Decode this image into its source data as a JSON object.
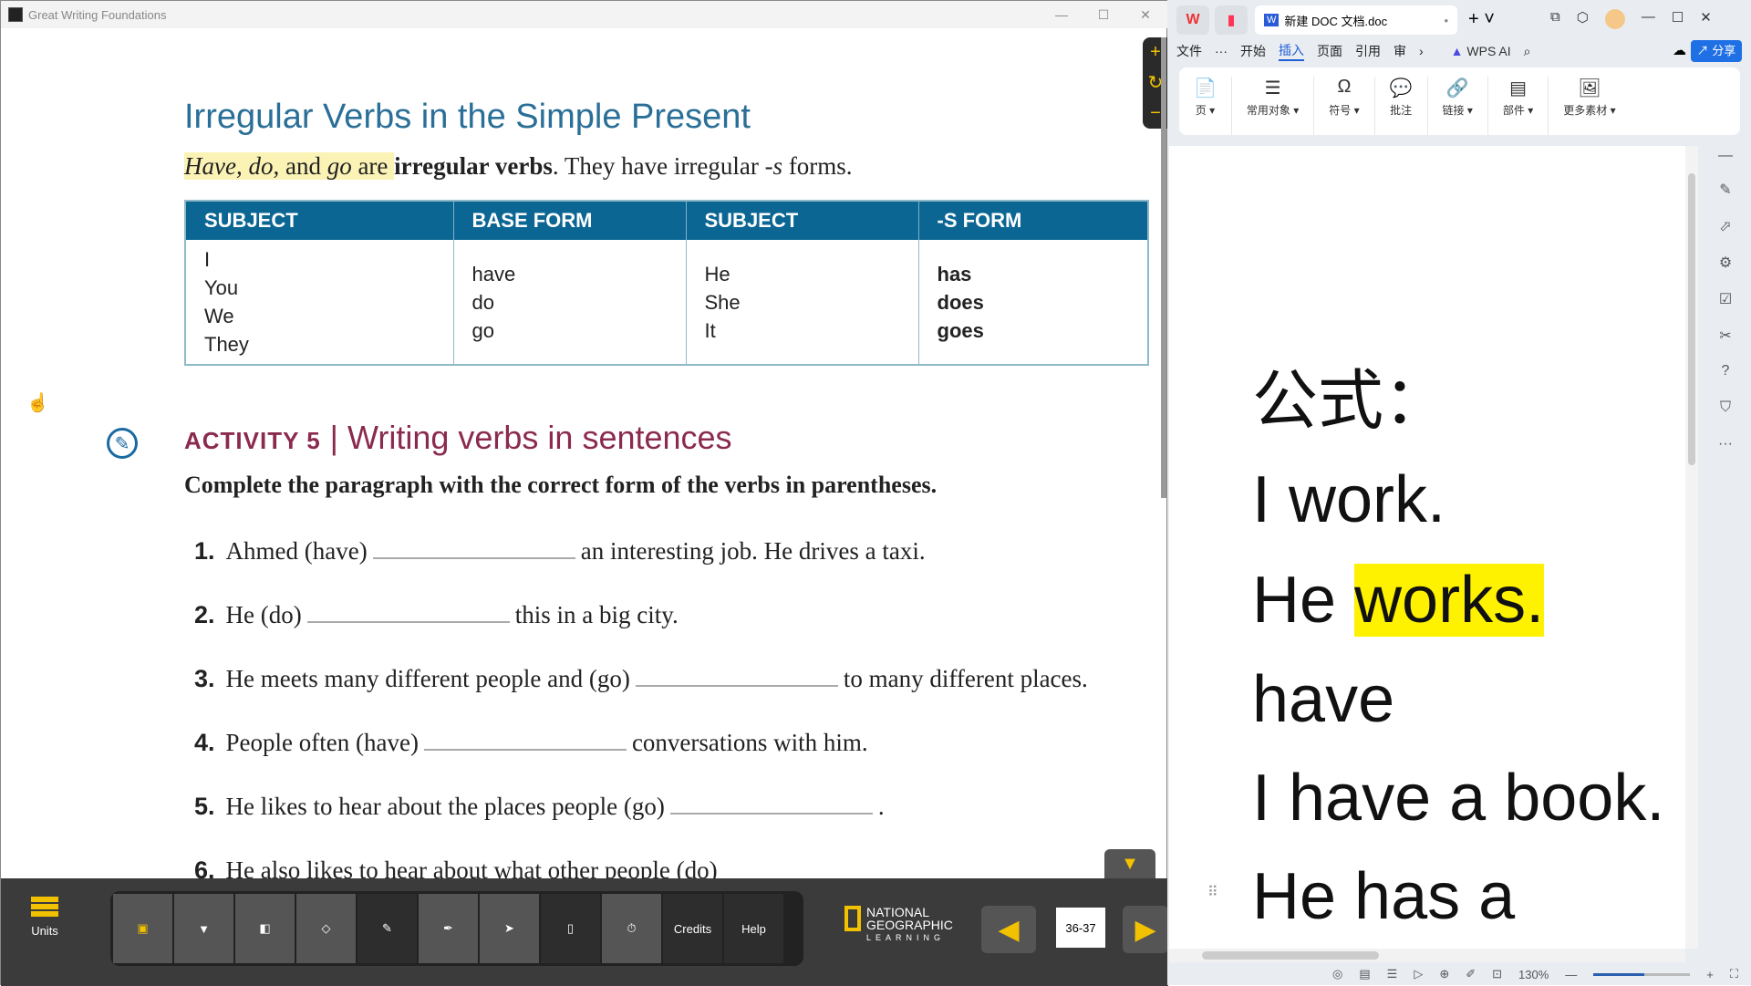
{
  "left_window": {
    "title": "Great Writing Foundations",
    "controls": [
      "—",
      "☐",
      "✕"
    ]
  },
  "book": {
    "title": "Irregular Verbs in the Simple Present",
    "sub_hl_italic1": "Have, do,",
    "sub_hl_and": " and ",
    "sub_hl_italic2": "go",
    "sub_hl_are": " are ",
    "sub_bold": "irregular verbs",
    "sub_rest": ". They have irregular ",
    "sub_s": "-s",
    "sub_end": " forms.",
    "table": {
      "headers": [
        "SUBJECT",
        "BASE FORM",
        "SUBJECT",
        "-S FORM"
      ],
      "subjects": [
        "I",
        "You",
        "We",
        "They"
      ],
      "base": [
        "have",
        "do",
        "go"
      ],
      "subjects3": [
        "He",
        "She",
        "It"
      ],
      "sforms": [
        "has",
        "does",
        "goes"
      ]
    },
    "activity_label": "ACTIVITY 5",
    "activity_title": "Writing verbs in sentences",
    "instruction": "Complete the paragraph with the correct form of the verbs in parentheses.",
    "items": [
      {
        "n": "1.",
        "pre": "Ahmed (have)",
        "post": "an interesting job. He drives a taxi."
      },
      {
        "n": "2.",
        "pre": "He (do)",
        "post": "this in a big city."
      },
      {
        "n": "3.",
        "pre": "He meets many different people and (go)",
        "post": "to many different places."
      },
      {
        "n": "4.",
        "pre": "People often (have)",
        "post": "conversations with him."
      },
      {
        "n": "5.",
        "pre": "He likes to hear about the places people (go)",
        "post": "."
      },
      {
        "n": "6.",
        "pre": "He also likes to hear about what other people (do)",
        "post": ""
      }
    ]
  },
  "toolbar": {
    "units": "Units",
    "credits": "Credits",
    "help": "Help",
    "logo": [
      "NATIONAL",
      "GEOGRAPHIC",
      "LEARNING"
    ],
    "page": "36-37"
  },
  "wps": {
    "tab_title": "新建 DOC 文档.doc",
    "menu": [
      "文件",
      "···",
      "开始",
      "插入",
      "页面",
      "引用",
      "审"
    ],
    "wps_ai": "WPS AI",
    "share": "分享",
    "ribbon": [
      {
        "icon": "📄",
        "label": "页 ▾"
      },
      {
        "icon": "☰",
        "label": "常用对象 ▾"
      },
      {
        "icon": "Ω",
        "label": "符号 ▾"
      },
      {
        "icon": "💬",
        "label": "批注"
      },
      {
        "icon": "🔗",
        "label": "链接 ▾"
      },
      {
        "icon": "▤",
        "label": "部件 ▾"
      },
      {
        "icon": "🖼",
        "label": "更多素材 ▾"
      }
    ],
    "doc_lines": [
      "公式：",
      "I work.",
      "He ",
      "works.",
      "have",
      "I have a book.",
      "He has a"
    ],
    "zoom": "130%",
    "highlight_color": "#fff200"
  }
}
